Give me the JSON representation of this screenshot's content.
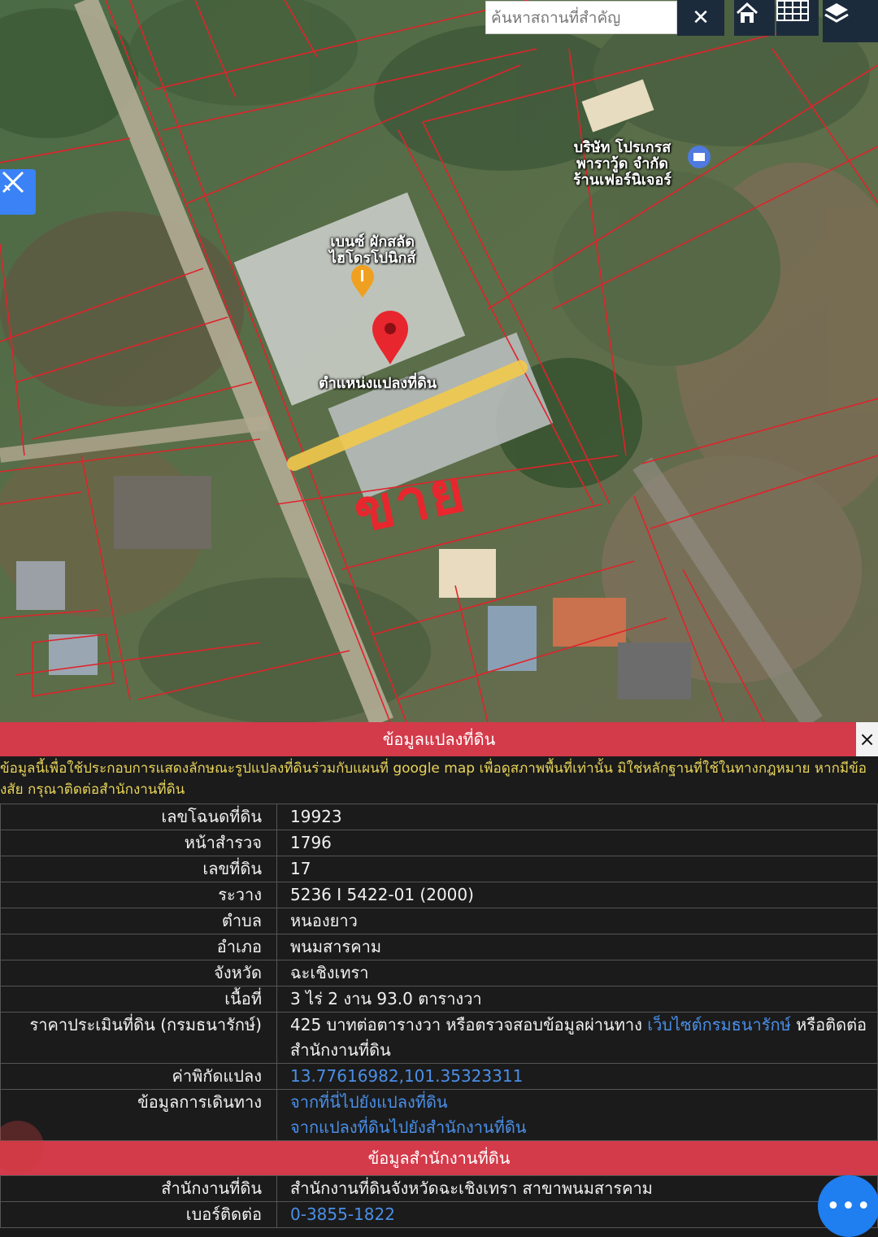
{
  "map": {
    "search_placeholder": "ค้นหาสถานที่สำคัญ",
    "labels": {
      "company": "บริษัท โปรเกรส\nพาราวู้ด จำกัด\nร้านเฟอร์นิเจอร์",
      "restaurant": "เบนซ์ ผักสลัด\nไฮโดรโปนิกส์",
      "parcel_position": "ตำแหน่งแปลงที่ดิน"
    },
    "handwritten_sale": "ขาย",
    "colors": {
      "parcel_lines": "#e0232b",
      "highlight": "#f2c94c",
      "pin": "#e8262d",
      "toolbar": "#1c2b3c"
    },
    "icons": [
      "close-icon",
      "home-icon",
      "grid-icon",
      "layers-icon",
      "draw-tool-icon",
      "map-pin-icon",
      "restaurant-pin-icon",
      "shop-pin-icon"
    ]
  },
  "panel": {
    "title": "ข้อมูลแปลงที่ดิน",
    "close_label": "×",
    "disclaimer_line1": "ข้อมูลนี้เพื่อใช้ประกอบการแสดงลักษณะรูปแปลงที่ดินร่วมกับแผนที่ google map เพื่อดูสภาพพื้นที่เท่านั้น มิใช่หลักฐานที่ใช้ในทางกฎหมาย หากมีข้อ",
    "disclaimer_line2": "งสัย กรุณาติดต่อสำนักงานที่ดิน",
    "rows": {
      "deed_no": {
        "label": "เลขโฉนดที่ดิน",
        "value": "19923"
      },
      "survey_page": {
        "label": "หน้าสำรวจ",
        "value": "1796"
      },
      "land_no": {
        "label": "เลขที่ดิน",
        "value": "17"
      },
      "ravang": {
        "label": "ระวาง",
        "value": "5236 I 5422-01 (2000)"
      },
      "tambon": {
        "label": "ตำบล",
        "value": "หนองยาว"
      },
      "amphoe": {
        "label": "อำเภอ",
        "value": "พนมสารคาม"
      },
      "province": {
        "label": "จังหวัด",
        "value": "ฉะเชิงเทรา"
      },
      "area": {
        "label": "เนื้อที่",
        "value": "3 ไร่ 2 งาน 93.0 ตารางวา"
      },
      "price": {
        "label": "ราคาประเมินที่ดิน (กรมธนารักษ์)",
        "value_pre": "425 บาทต่อตารางวา หรือตรวจสอบข้อมูลผ่านทาง ",
        "link": "เว็บไซต์กรมธนารักษ์",
        "value_post": " หรือติดต่อ",
        "value_line2": "สำนักงานที่ดิน"
      },
      "coords": {
        "label": "ค่าพิกัดแปลง",
        "value": "13.77616982,101.35323311"
      },
      "travel": {
        "label": "ข้อมูลการเดินทาง",
        "link1": "จากที่นี่ไปยังแปลงที่ดิน",
        "link2": "จากแปลงที่ดินไปยังสำนักงานที่ดิน"
      }
    },
    "office_title": "ข้อมูลสำนักงานที่ดิน",
    "office_rows": {
      "office": {
        "label": "สำนักงานที่ดิน",
        "value": "สำนักงานที่ดินจังหวัดฉะเชิงเทรา สาขาพนมสารคาม"
      },
      "phone": {
        "label": "เบอร์ติดต่อ",
        "value": "0-3855-1822"
      }
    }
  },
  "fab_label": "•••"
}
